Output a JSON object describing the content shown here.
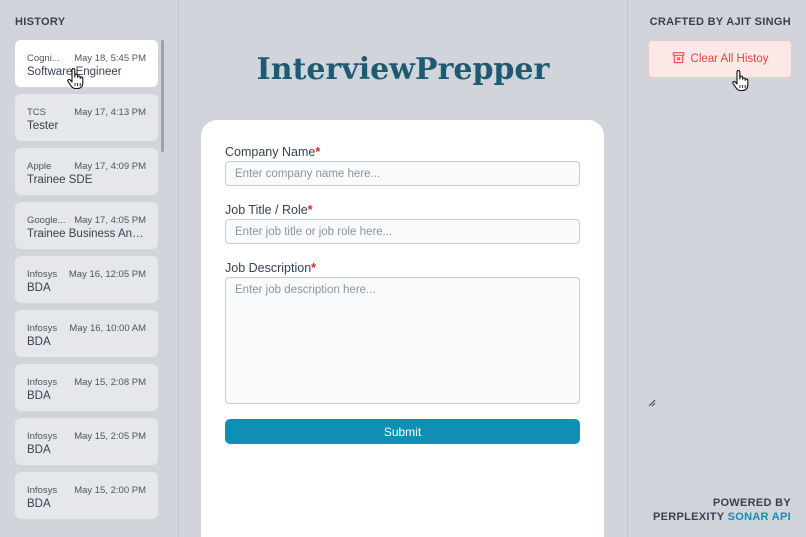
{
  "sidebar": {
    "title": "HISTORY",
    "items": [
      {
        "company": "Cogni...",
        "date": "May 18, 5:45 PM",
        "role": "Software Engineer",
        "active": true
      },
      {
        "company": "TCS",
        "date": "May 17, 4:13 PM",
        "role": "Tester"
      },
      {
        "company": "Apple",
        "date": "May 17, 4:09 PM",
        "role": "Trainee SDE"
      },
      {
        "company": "Google...",
        "date": "May 17, 4:05 PM",
        "role": "Trainee Business Anal..."
      },
      {
        "company": "Infosys",
        "date": "May 16, 12:05 PM",
        "role": "BDA"
      },
      {
        "company": "Infosys",
        "date": "May 16, 10:00 AM",
        "role": "BDA"
      },
      {
        "company": "Infosys",
        "date": "May 15, 2:08 PM",
        "role": "BDA"
      },
      {
        "company": "Infosys",
        "date": "May 15, 2:05 PM",
        "role": "BDA"
      },
      {
        "company": "Infosys",
        "date": "May 15, 2:00 PM",
        "role": "BDA"
      }
    ]
  },
  "header": {
    "app_title": "InterviewPrepper"
  },
  "form": {
    "company_label": "Company Name",
    "company_placeholder": "Enter company name here...",
    "job_title_label": "Job Title / Role",
    "job_title_placeholder": "Enter job title or job role here...",
    "description_label": "Job Description",
    "description_placeholder": "Enter job description here...",
    "required_mark": "*",
    "submit_label": "Submit"
  },
  "right_panel": {
    "crafted_by": "CRAFTED BY AJIT SINGH",
    "clear_button": "Clear All Histoy",
    "powered_by_line1": "POWERED BY",
    "powered_by_prefix": "PERPLEXITY",
    "powered_by_accent": "SONAR API"
  },
  "colors": {
    "accent": "#0e8fb3",
    "title": "#1e5a72",
    "danger": "#e04646",
    "background": "#d1d5db"
  },
  "icons": {
    "clear_button_icon": "archive-x-icon",
    "cursor": "hand-pointer-icon"
  }
}
